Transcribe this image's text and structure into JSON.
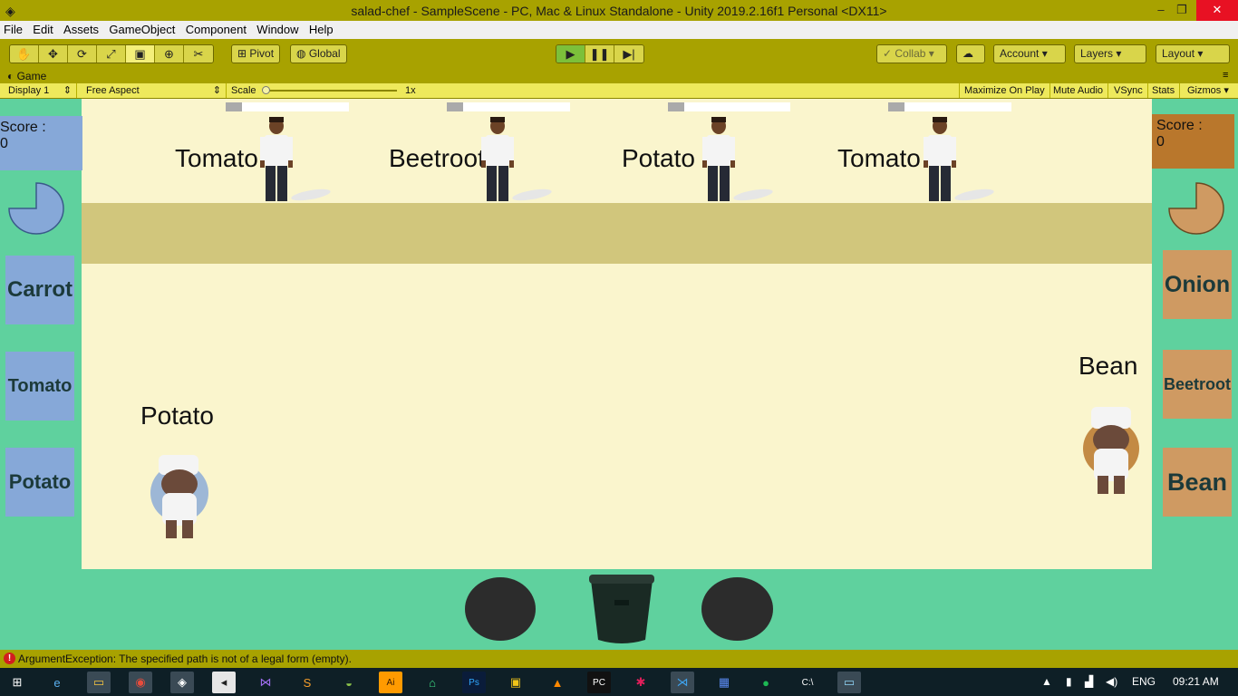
{
  "window": {
    "title": "salad-chef - SampleScene - PC, Mac & Linux Standalone - Unity 2019.2.16f1 Personal <DX11>",
    "minimize": "–",
    "maximize": "❐",
    "close": "✕"
  },
  "menu": [
    "File",
    "Edit",
    "Assets",
    "GameObject",
    "Component",
    "Window",
    "Help"
  ],
  "toolbar": {
    "pivot": "Pivot",
    "global": "Global",
    "collab": "Collab",
    "account": "Account",
    "layers": "Layers",
    "layout": "Layout"
  },
  "game_tab": {
    "label": "Game",
    "display": "Display 1",
    "aspect": "Free Aspect",
    "scale_label": "Scale",
    "scale_value": "1x",
    "maximize_on_play": "Maximize On Play",
    "mute_audio": "Mute Audio",
    "vsync": "VSync",
    "stats": "Stats",
    "gizmos": "Gizmos"
  },
  "game": {
    "customers": [
      {
        "order": "Tomato",
        "patience": 0.13
      },
      {
        "order": "Beetroot",
        "patience": 0.13
      },
      {
        "order": "Potato",
        "patience": 0.13
      },
      {
        "order": "Tomato",
        "patience": 0.13
      }
    ],
    "player1": {
      "score_label": "Score :",
      "score": "0",
      "held_item": "Potato",
      "color": "#86a8d8",
      "vegetables": [
        "Carrot",
        "Tomato",
        "Potato"
      ]
    },
    "player2": {
      "score_label": "Score :",
      "score": "0",
      "held_item": "Bean",
      "color": "#b9772c",
      "vegetables": [
        "Onion",
        "Beetroot",
        "Bean"
      ]
    }
  },
  "console": {
    "message": "ArgumentException: The specified path is not of a legal form (empty)."
  },
  "taskbar": {
    "language": "ENG",
    "time": "09:21 AM"
  }
}
